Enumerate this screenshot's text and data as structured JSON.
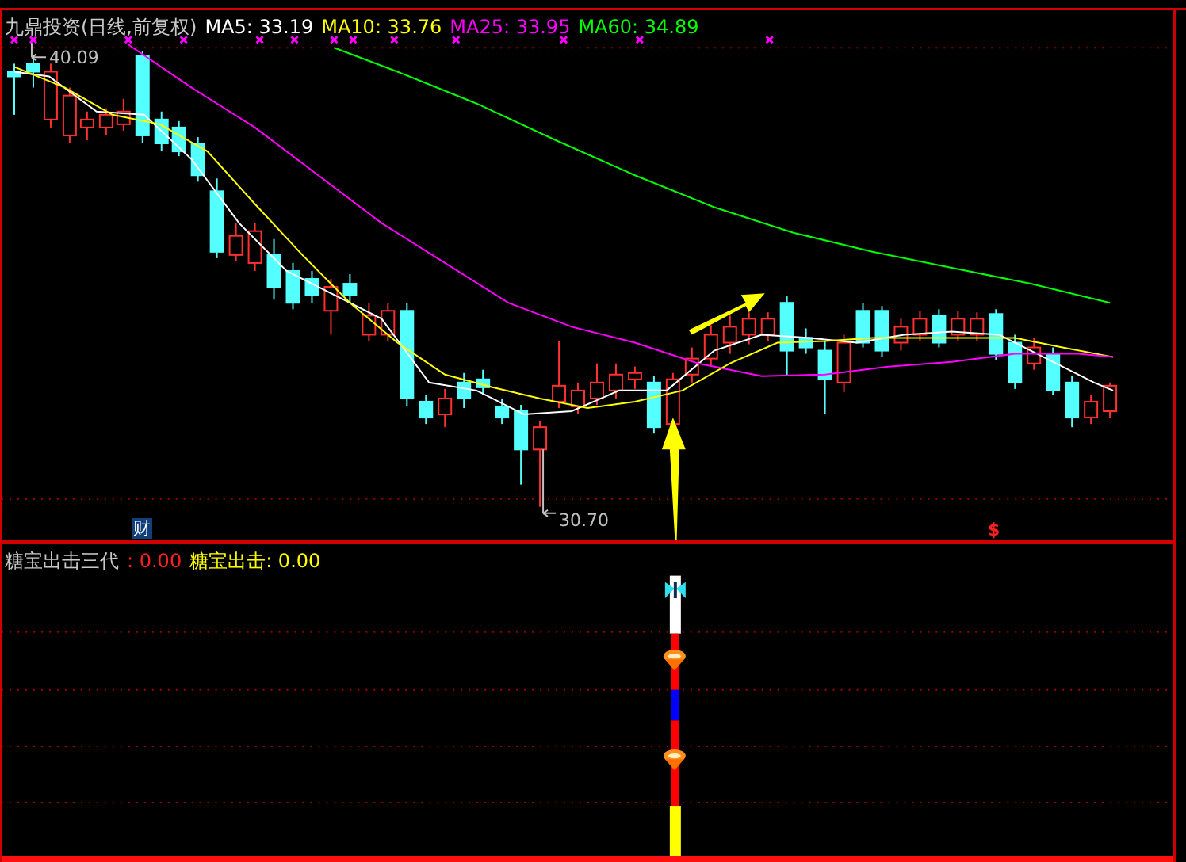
{
  "title": "九鼎投资(日线,前复权)",
  "moving_averages": [
    {
      "label": "MA5: 33.19",
      "color": "#ffffff"
    },
    {
      "label": "MA10: 33.76",
      "color": "#ffff00"
    },
    {
      "label": "MA25: 33.95",
      "color": "#ff00ff"
    },
    {
      "label": "MA60: 34.89",
      "color": "#00ff00"
    }
  ],
  "price_markers": [
    {
      "kind": "high",
      "text": "40.09"
    },
    {
      "kind": "low",
      "text": "30.70"
    }
  ],
  "finance_badge": "财",
  "signal_mark": "$",
  "indicator": {
    "name": "糖宝出击三代",
    "value": ": 0.00",
    "series_label": "糖宝出击: 0.00"
  }
}
